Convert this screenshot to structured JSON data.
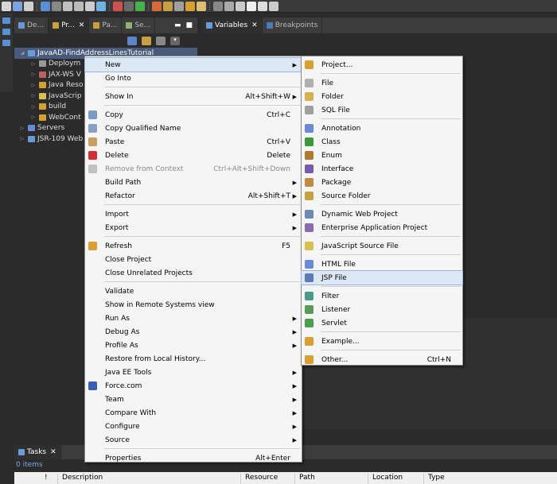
{
  "colors": {
    "menu_bg": "#f5f5f5",
    "menu_highlight": "#dde8f7",
    "dark_bg": "#2b2b2b",
    "selection": "#4a5a7a"
  },
  "explorer_tabs": [
    {
      "label": "De...",
      "icon": "debug-icon"
    },
    {
      "label": "Pr...",
      "icon": "project-explorer-icon"
    },
    {
      "label": "Pa...",
      "icon": "package-explorer-icon"
    },
    {
      "label": "Se...",
      "icon": "servers-icon"
    }
  ],
  "variables_tabs": [
    {
      "label": "Variables",
      "icon": "variables-icon"
    },
    {
      "label": "Breakpoints",
      "icon": "breakpoints-icon"
    }
  ],
  "tree": [
    {
      "label": "JavaAD-FindAddressLinesTutorial",
      "expanded": true,
      "selected": true,
      "level": 0
    },
    {
      "label": "Deploym",
      "level": 1
    },
    {
      "label": "JAX-WS V",
      "level": 1
    },
    {
      "label": "Java Reso",
      "level": 1
    },
    {
      "label": "JavaScrip",
      "level": 1
    },
    {
      "label": "build",
      "level": 1
    },
    {
      "label": "WebCont",
      "level": 1
    },
    {
      "label": "Servers",
      "level": 0
    },
    {
      "label": "JSR-109 Web",
      "level": 0
    }
  ],
  "context_menu": [
    {
      "label": "New",
      "submenu": true,
      "highlighted": true
    },
    {
      "label": "Go Into"
    },
    {
      "sep": true
    },
    {
      "label": "Show In",
      "shortcut": "Alt+Shift+W",
      "submenu": true
    },
    {
      "sep": true
    },
    {
      "label": "Copy",
      "shortcut": "Ctrl+C",
      "icon": "copy-icon"
    },
    {
      "label": "Copy Qualified Name",
      "icon": "copy-qualified-icon"
    },
    {
      "label": "Paste",
      "shortcut": "Ctrl+V",
      "icon": "paste-icon"
    },
    {
      "label": "Delete",
      "shortcut": "Delete",
      "icon": "delete-icon"
    },
    {
      "label": "Remove from Context",
      "shortcut": "Ctrl+Alt+Shift+Down",
      "disabled": true,
      "icon": "remove-context-icon"
    },
    {
      "label": "Build Path",
      "submenu": true
    },
    {
      "label": "Refactor",
      "shortcut": "Alt+Shift+T",
      "submenu": true
    },
    {
      "sep": true
    },
    {
      "label": "Import",
      "submenu": true
    },
    {
      "label": "Export",
      "submenu": true
    },
    {
      "sep": true
    },
    {
      "label": "Refresh",
      "shortcut": "F5",
      "icon": "refresh-icon"
    },
    {
      "label": "Close Project"
    },
    {
      "label": "Close Unrelated Projects"
    },
    {
      "sep": true
    },
    {
      "label": "Validate"
    },
    {
      "label": "Show in Remote Systems view"
    },
    {
      "label": "Run As",
      "submenu": true
    },
    {
      "label": "Debug As",
      "submenu": true
    },
    {
      "label": "Profile As",
      "submenu": true
    },
    {
      "label": "Restore from Local History..."
    },
    {
      "label": "Java EE Tools",
      "submenu": true
    },
    {
      "label": "Force.com",
      "submenu": true,
      "icon": "force-com-icon"
    },
    {
      "label": "Team",
      "submenu": true
    },
    {
      "label": "Compare With",
      "submenu": true
    },
    {
      "label": "Configure",
      "submenu": true
    },
    {
      "label": "Source",
      "submenu": true
    },
    {
      "sep": true
    },
    {
      "label": "Properties",
      "shortcut": "Alt+Enter"
    }
  ],
  "new_submenu": [
    {
      "label": "Project...",
      "icon": "project-icon"
    },
    {
      "sep": true
    },
    {
      "label": "File",
      "icon": "file-icon"
    },
    {
      "label": "Folder",
      "icon": "folder-icon"
    },
    {
      "label": "SQL File",
      "icon": "sql-file-icon"
    },
    {
      "sep": true
    },
    {
      "label": "Annotation",
      "icon": "annotation-icon"
    },
    {
      "label": "Class",
      "icon": "class-icon"
    },
    {
      "label": "Enum",
      "icon": "enum-icon"
    },
    {
      "label": "Interface",
      "icon": "interface-icon"
    },
    {
      "label": "Package",
      "icon": "package-icon"
    },
    {
      "label": "Source Folder",
      "icon": "source-folder-icon"
    },
    {
      "sep": true
    },
    {
      "label": "Dynamic Web Project",
      "icon": "dynamic-web-project-icon"
    },
    {
      "label": "Enterprise Application Project",
      "icon": "enterprise-app-icon"
    },
    {
      "sep": true
    },
    {
      "label": "JavaScript Source File",
      "icon": "javascript-file-icon"
    },
    {
      "sep": true
    },
    {
      "label": "HTML File",
      "icon": "html-file-icon"
    },
    {
      "label": "JSP File",
      "icon": "jsp-file-icon",
      "highlighted": true
    },
    {
      "sep": true
    },
    {
      "label": "Filter",
      "icon": "filter-icon"
    },
    {
      "label": "Listener",
      "icon": "listener-icon"
    },
    {
      "label": "Servlet",
      "icon": "servlet-icon"
    },
    {
      "sep": true
    },
    {
      "label": "Example...",
      "icon": "example-icon"
    },
    {
      "sep": true
    },
    {
      "label": "Other...",
      "shortcut": "Ctrl+N",
      "icon": "other-icon"
    }
  ],
  "tasks_panel": {
    "tab_label": "Tasks",
    "count": "0 items",
    "columns": [
      "!",
      "Description",
      "Resource",
      "Path",
      "Location",
      "Type"
    ]
  }
}
